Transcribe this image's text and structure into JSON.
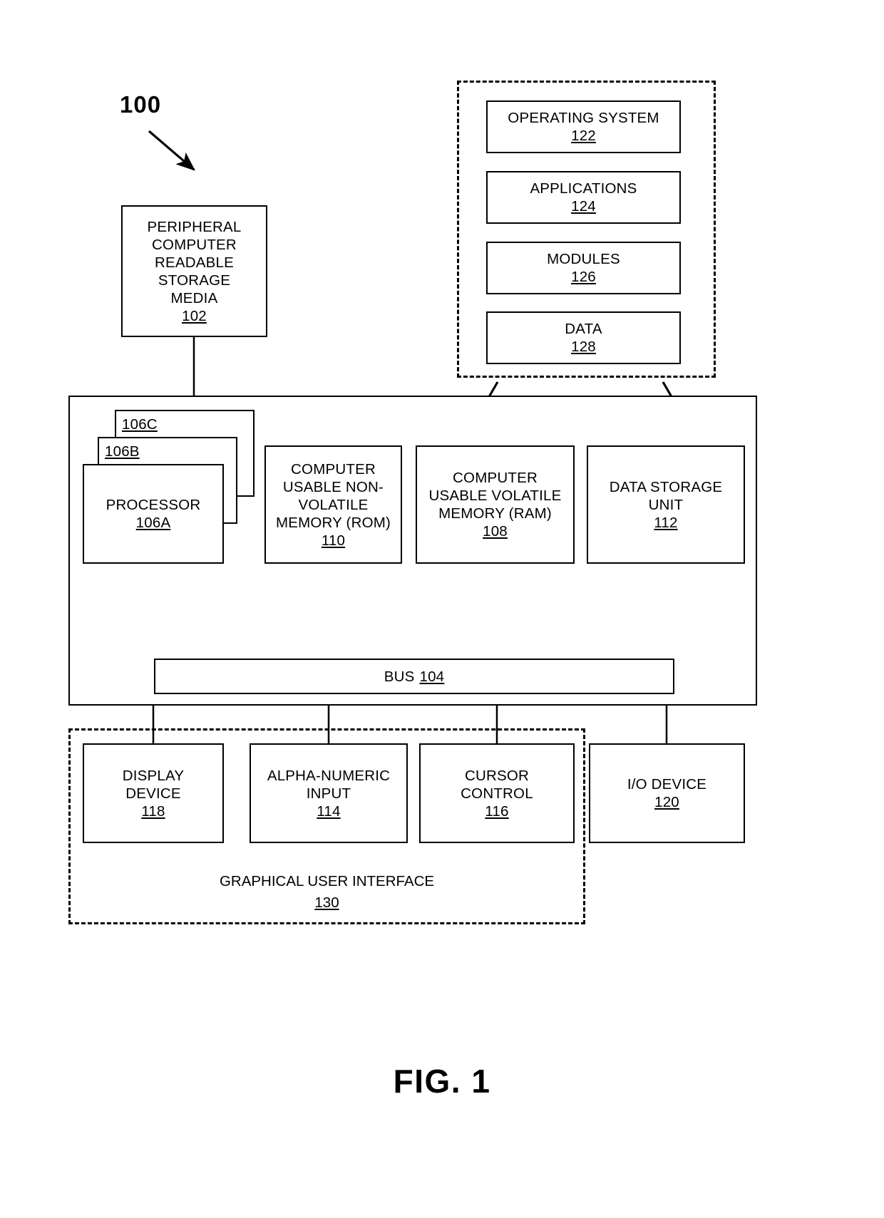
{
  "figure": {
    "number_label": "100",
    "caption": "FIG. 1"
  },
  "memory_container": {
    "name": "memory-contents-container",
    "items": [
      {
        "title": "OPERATING SYSTEM",
        "ref": "122"
      },
      {
        "title": "APPLICATIONS",
        "ref": "124"
      },
      {
        "title": "MODULES",
        "ref": "126"
      },
      {
        "title": "DATA",
        "ref": "128"
      }
    ]
  },
  "peripheral_storage": {
    "title": "PERIPHERAL\nCOMPUTER\nREADABLE\nSTORAGE\nMEDIA",
    "ref": "102"
  },
  "processor_stack": {
    "back": {
      "ref": "106C"
    },
    "middle": {
      "ref": "106B"
    },
    "front": {
      "title": "PROCESSOR",
      "ref": "106A"
    }
  },
  "memory_row": [
    {
      "title": "COMPUTER\nUSABLE NON-\nVOLATILE\nMEMORY (ROM)",
      "ref": "110"
    },
    {
      "title": "COMPUTER\nUSABLE VOLATILE\nMEMORY (RAM)",
      "ref": "108"
    },
    {
      "title": "DATA STORAGE\nUNIT",
      "ref": "112"
    }
  ],
  "bus": {
    "title": "BUS",
    "ref": "104"
  },
  "gui": {
    "title": "GRAPHICAL USER INTERFACE",
    "ref": "130"
  },
  "devices": [
    {
      "title": "DISPLAY\nDEVICE",
      "ref": "118"
    },
    {
      "title": "ALPHA-NUMERIC\nINPUT",
      "ref": "114"
    },
    {
      "title": "CURSOR\nCONTROL",
      "ref": "116"
    },
    {
      "title": "I/O DEVICE",
      "ref": "120"
    }
  ],
  "colors": {
    "stroke": "#000000",
    "background": "#ffffff"
  }
}
